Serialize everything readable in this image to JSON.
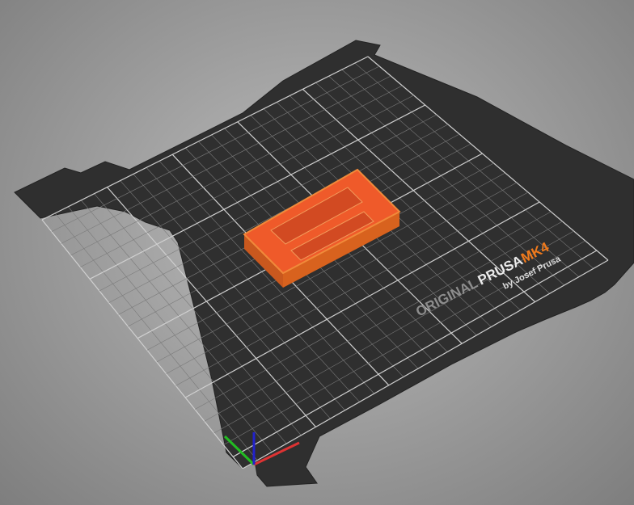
{
  "viewport": {
    "name": "3D scene"
  },
  "bed": {
    "logo_original": "ORIGINAL",
    "logo_prusa": "PRUSA",
    "logo_model": "MK4",
    "logo_byline": "by Josef Prusa",
    "colors": {
      "bed": "#2e2e2e",
      "grid": "#8a8a8a",
      "accent": "#f07a1c",
      "object": "#ef5a2a"
    }
  }
}
